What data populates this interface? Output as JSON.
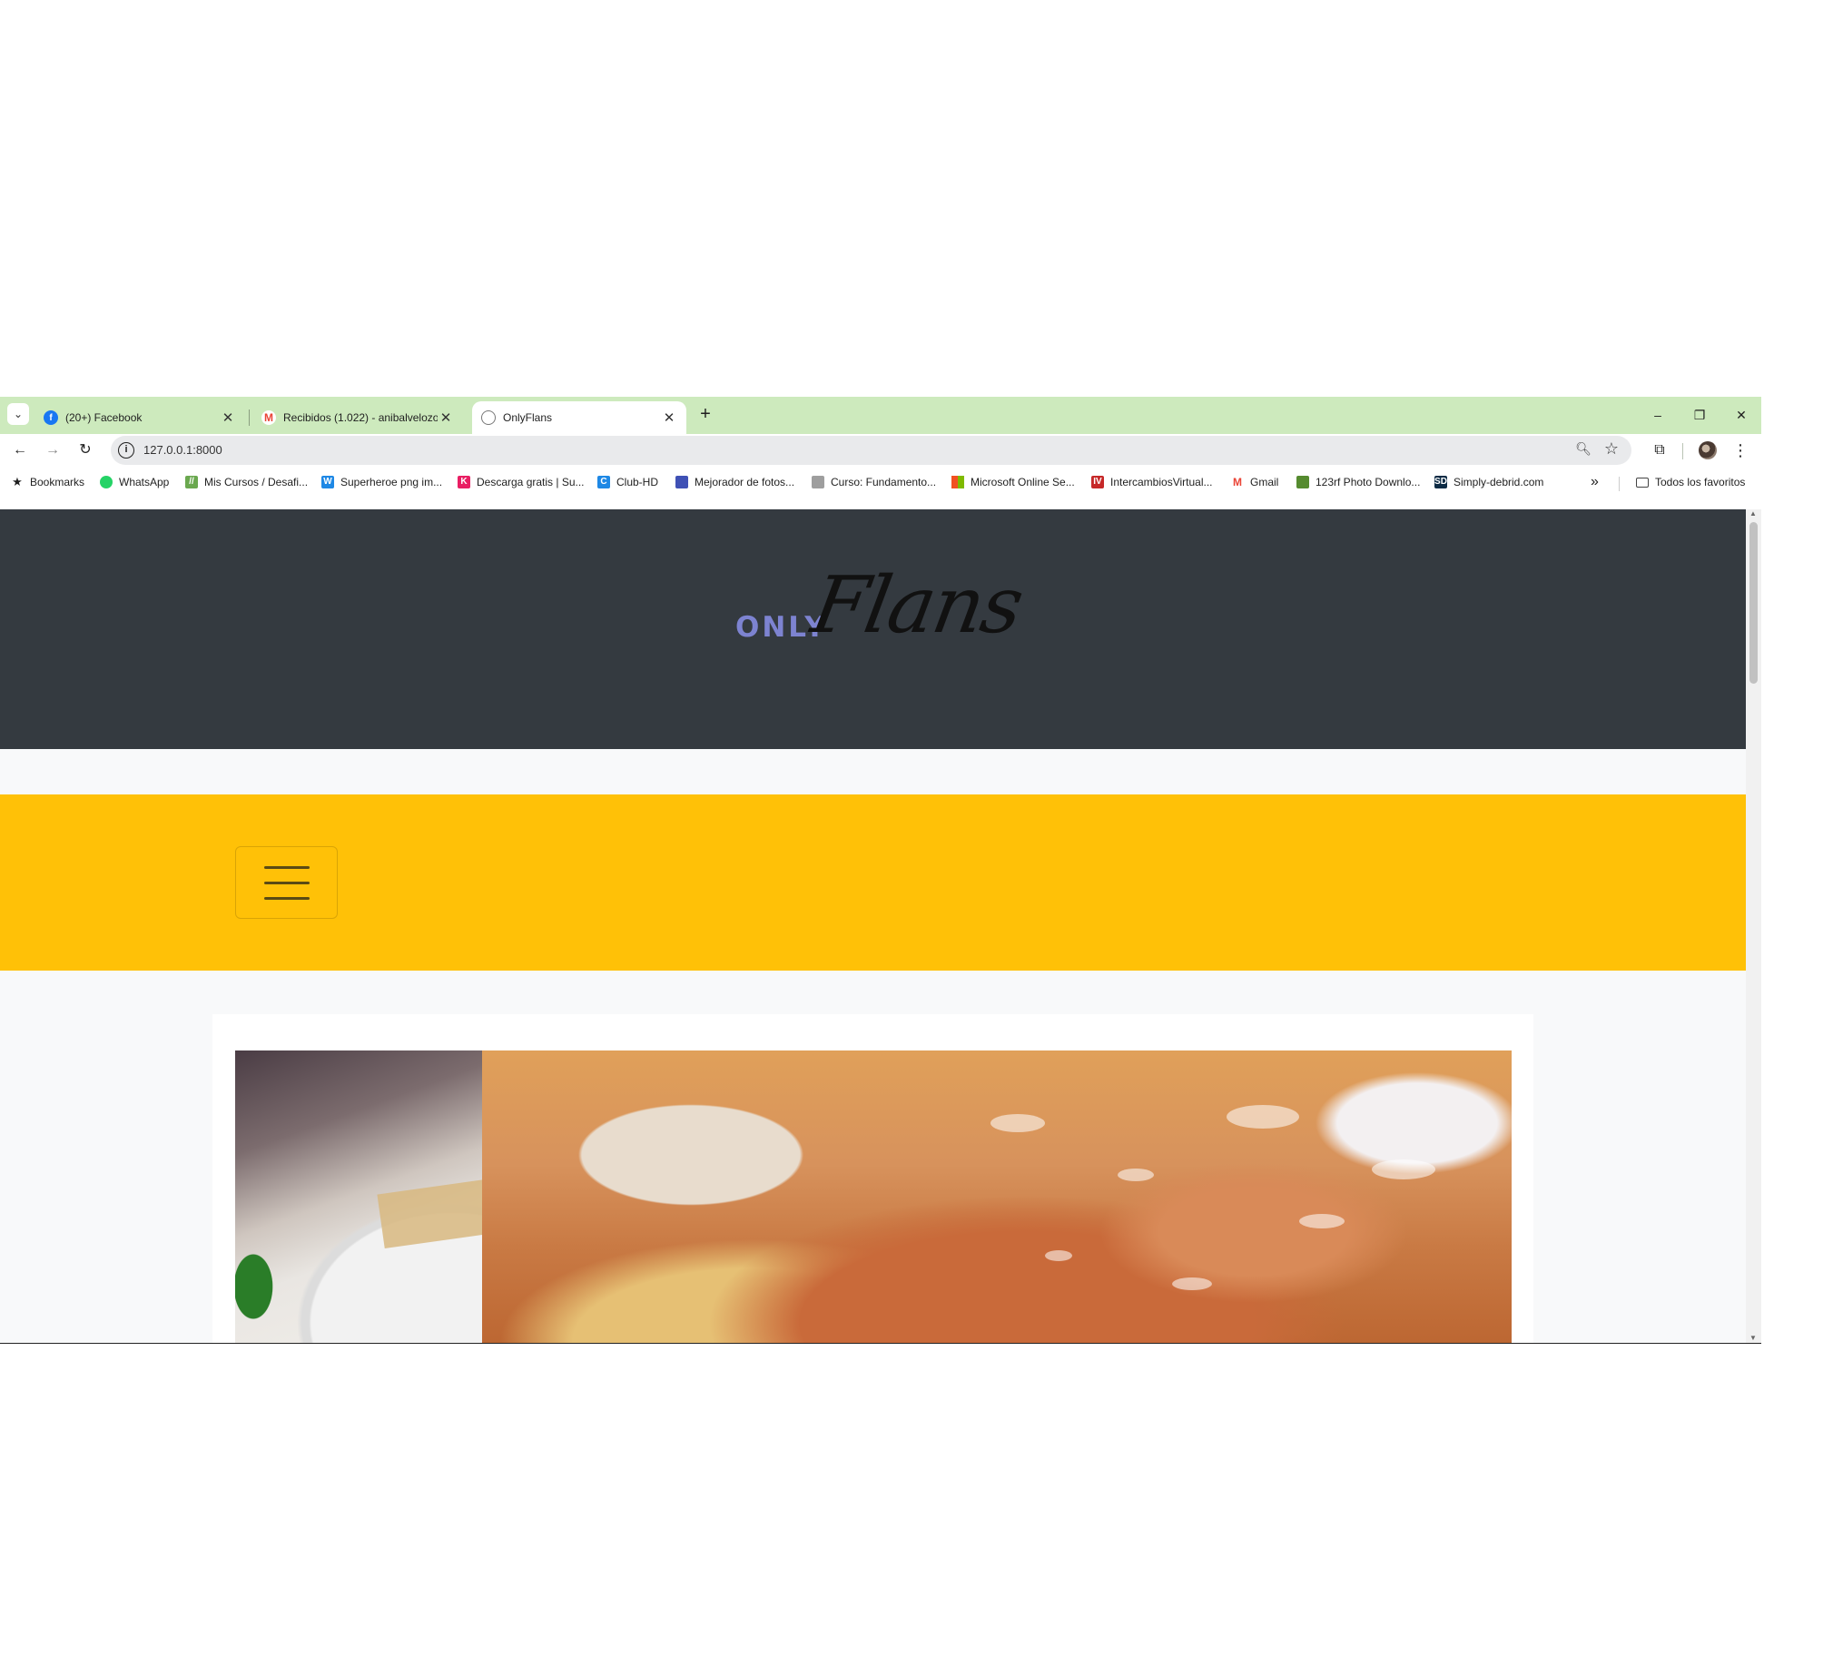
{
  "browser": {
    "tabs": [
      {
        "title": "(20+) Facebook",
        "favicon": "facebook-icon",
        "active": false
      },
      {
        "title": "Recibidos (1.022) - anibalvelozo",
        "favicon": "gmail-icon",
        "active": false
      },
      {
        "title": "OnlyFlans",
        "favicon": "globe-icon",
        "active": true
      }
    ],
    "address": "127.0.0.1:8000",
    "bookmarks_label": "Bookmarks",
    "bookmarks": [
      {
        "label": "WhatsApp",
        "color": "#25d366"
      },
      {
        "label": "Mis Cursos / Desafi...",
        "color": "#6aa84f"
      },
      {
        "label": "Superheroe png im...",
        "color": "#1e88e5"
      },
      {
        "label": "Descarga gratis | Su...",
        "color": "#e91e63"
      },
      {
        "label": "Club-HD",
        "color": "#1e88e5"
      },
      {
        "label": "Mejorador de fotos...",
        "color": "#3f51b5"
      },
      {
        "label": "Curso: Fundamento...",
        "color": "#9e9e9e"
      },
      {
        "label": "Microsoft Online Se...",
        "color": "#f25022"
      },
      {
        "label": "IntercambiosVirtual...",
        "color": "#c62828"
      },
      {
        "label": "Gmail",
        "color": "#ea4335"
      },
      {
        "label": "123rf Photo Downlo...",
        "color": "#558b2f"
      },
      {
        "label": "Simply-debrid.com",
        "color": "#0d2b45"
      }
    ],
    "all_bookmarks_label": "Todos los favoritos"
  },
  "site": {
    "logo_small": "ONLY",
    "logo_script": "Flans",
    "colors": {
      "header": "#343a40",
      "navbar": "#ffc107",
      "logo_accent": "#7d83d1"
    }
  }
}
